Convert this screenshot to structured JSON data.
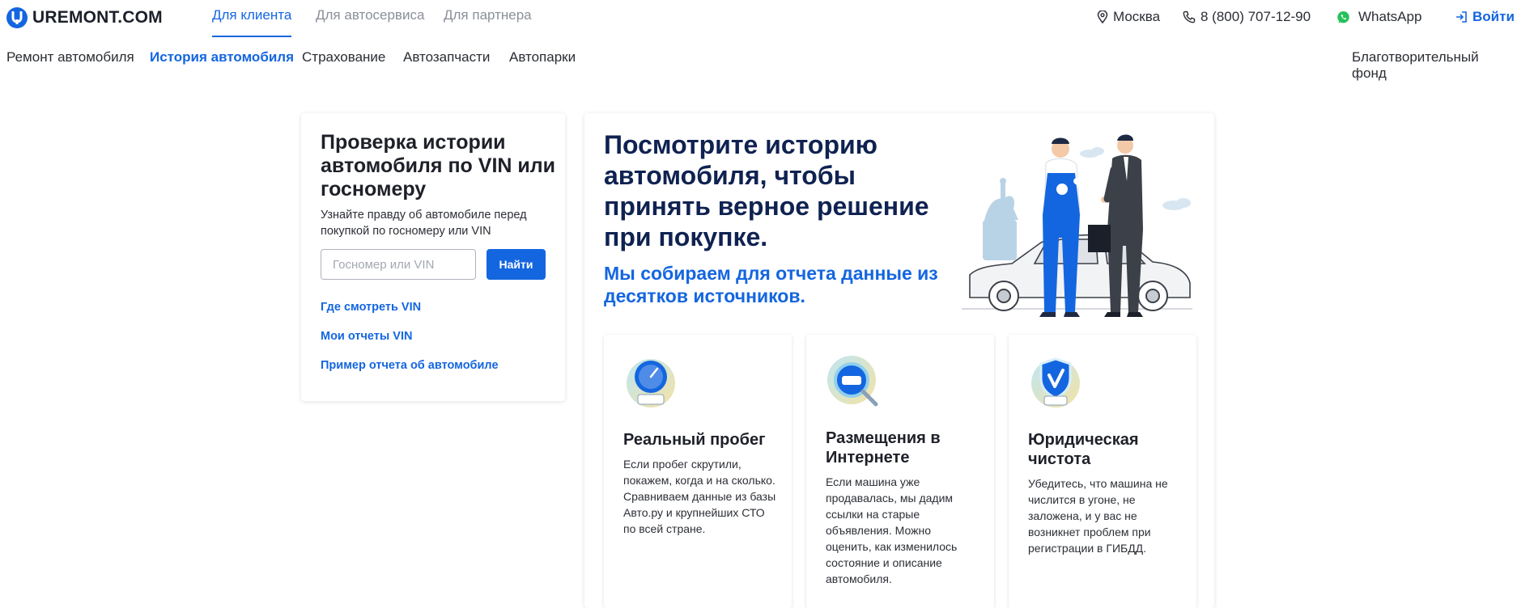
{
  "brand": {
    "name": "UREMONT.COM",
    "accent": "#1466e0"
  },
  "audience_tabs": [
    {
      "label": "Для клиента",
      "active": true
    },
    {
      "label": "Для автосервиса",
      "active": false
    },
    {
      "label": "Для партнера",
      "active": false
    }
  ],
  "top_right": {
    "city": "Москва",
    "phone": "8 (800) 707-12-90",
    "whatsapp": "WhatsApp",
    "login": "Войти"
  },
  "nav": {
    "items": [
      {
        "label": "Ремонт автомобиля",
        "active": false
      },
      {
        "label": "История автомобиля",
        "active": true
      },
      {
        "label": "Страхование",
        "active": false
      },
      {
        "label": "Автозапчасти",
        "active": false
      },
      {
        "label": "Автопарки",
        "active": false
      }
    ],
    "charity": "Благотворительный фонд"
  },
  "search": {
    "title": "Проверка истории автомобиля по VIN или госномеру",
    "subtitle": "Узнайте правду об автомобиле перед покупкой по госномеру или VIN",
    "placeholder": "Госномер или VIN",
    "button": "Найти",
    "links": [
      "Где смотреть VIN",
      "Мои отчеты VIN",
      "Пример отчета об автомобиле"
    ]
  },
  "hero": {
    "title": "Посмотрите историю автомобиля, чтобы принять верное решение при покупке.",
    "subtitle": "Мы собираем для отчета данные из десятков источников."
  },
  "features": [
    {
      "title": "Реальный пробег",
      "text": "Если пробег скрутили, покажем, когда и на сколько. Сравниваем данные из базы Авто.ру и крупнейших СТО по всей стране.",
      "icon": "speedometer-icon"
    },
    {
      "title": "Размещения в Интернете",
      "text": "Если машина уже продавалась, мы дадим ссылки на старые объявления. Можно оценить, как изменилось состояние и описание автомобиля.",
      "icon": "magnifier-car-icon"
    },
    {
      "title": "Юридическая чистота",
      "text": "Убедитесь, что машина не числится в угоне, не заложена, и у вас не возникнет проблем при регистрации в ГИБДД.",
      "icon": "shield-check-icon"
    }
  ]
}
